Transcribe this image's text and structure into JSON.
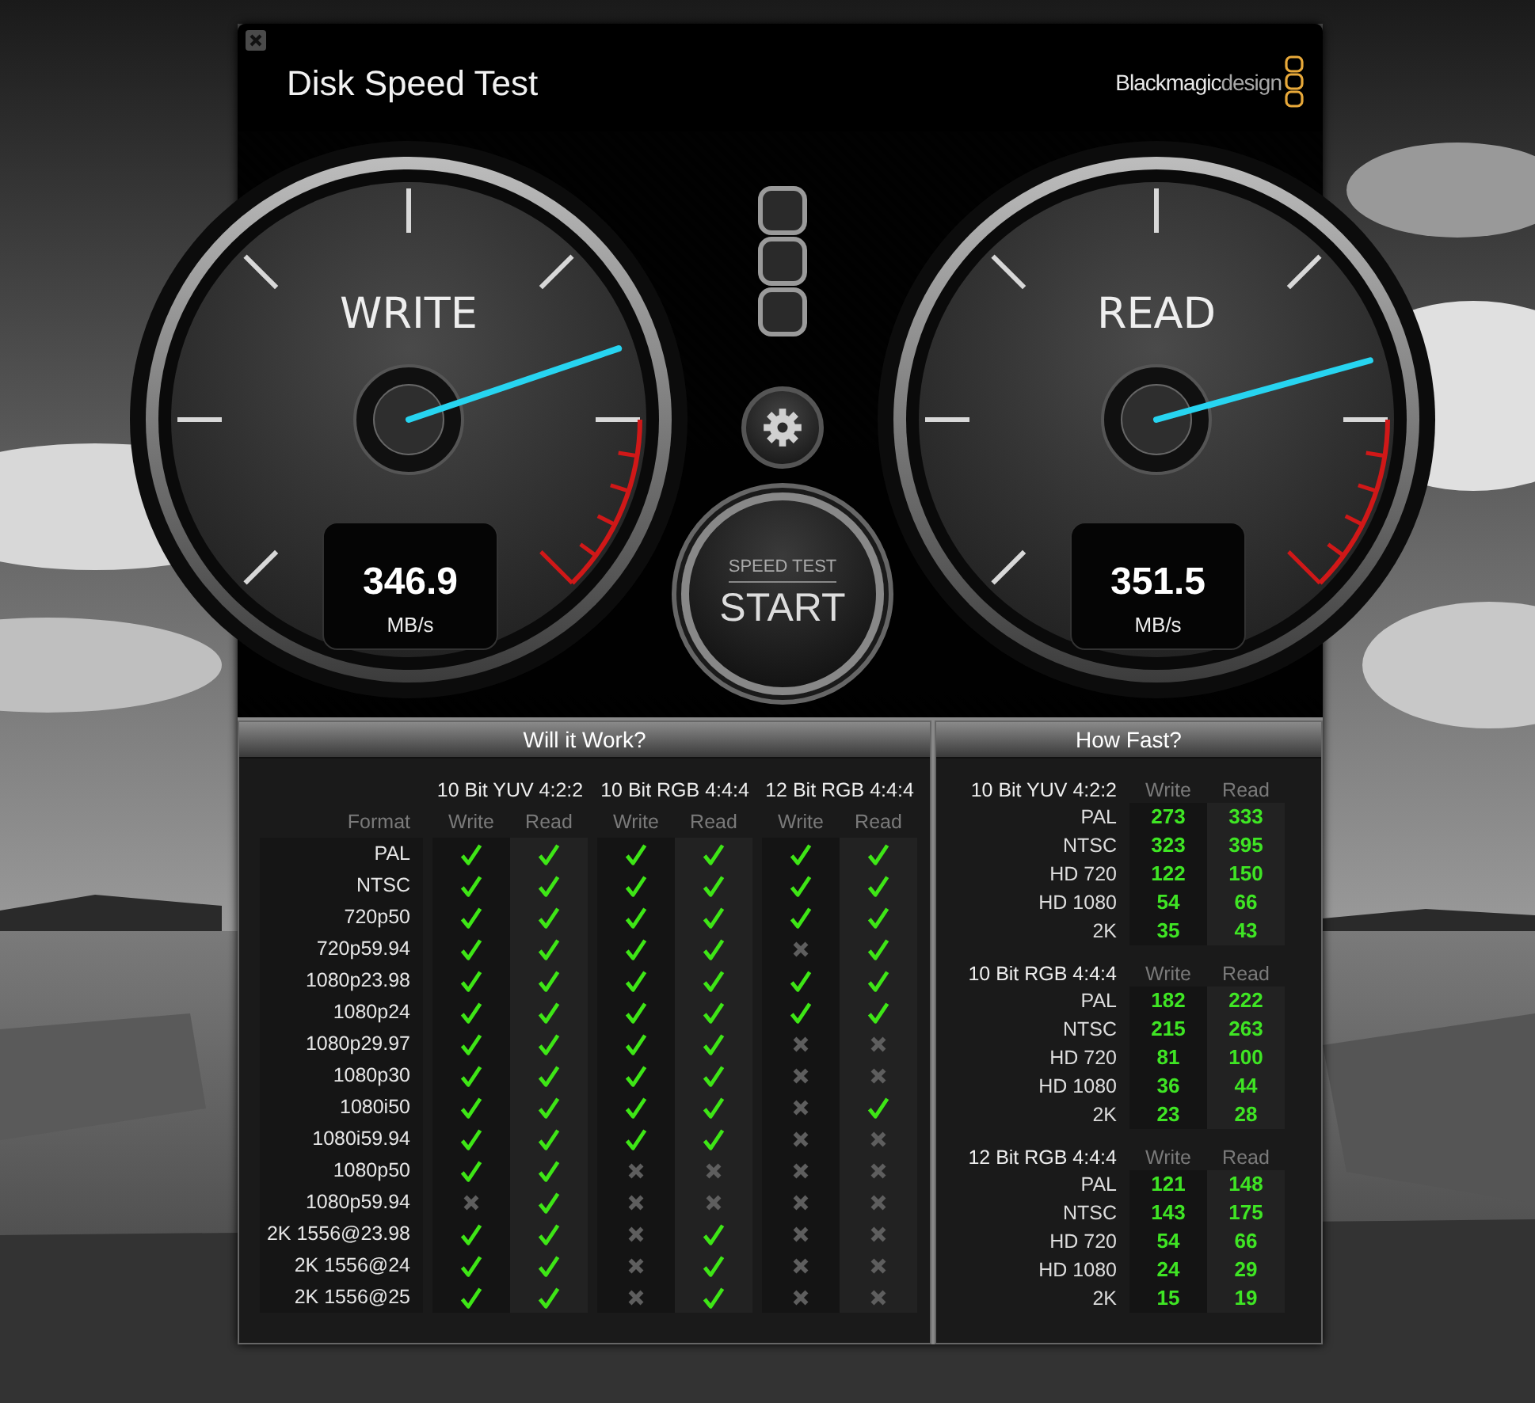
{
  "window": {
    "title": "Disk Speed Test"
  },
  "brand": {
    "name": "Blackmagic",
    "suffix": "design"
  },
  "gauges": [
    {
      "label": "WRITE",
      "value": "346.9",
      "unit": "MB/s",
      "level": 0.764
    },
    {
      "label": "READ",
      "value": "351.5",
      "unit": "MB/s",
      "level": 0.776
    }
  ],
  "start_button": {
    "caption": "SPEED TEST",
    "label": "START"
  },
  "will_it_work": {
    "title": "Will it Work?",
    "format_heading": "Format",
    "groups": [
      {
        "name": "10 Bit YUV 4:2:2",
        "columns": [
          "Write",
          "Read"
        ]
      },
      {
        "name": "10 Bit RGB 4:4:4",
        "columns": [
          "Write",
          "Read"
        ]
      },
      {
        "name": "12 Bit RGB 4:4:4",
        "columns": [
          "Write",
          "Read"
        ]
      }
    ],
    "rows": [
      {
        "format": "PAL",
        "results": [
          true,
          true,
          true,
          true,
          true,
          true
        ]
      },
      {
        "format": "NTSC",
        "results": [
          true,
          true,
          true,
          true,
          true,
          true
        ]
      },
      {
        "format": "720p50",
        "results": [
          true,
          true,
          true,
          true,
          true,
          true
        ]
      },
      {
        "format": "720p59.94",
        "results": [
          true,
          true,
          true,
          true,
          false,
          true
        ]
      },
      {
        "format": "1080p23.98",
        "results": [
          true,
          true,
          true,
          true,
          true,
          true
        ]
      },
      {
        "format": "1080p24",
        "results": [
          true,
          true,
          true,
          true,
          true,
          true
        ]
      },
      {
        "format": "1080p29.97",
        "results": [
          true,
          true,
          true,
          true,
          false,
          false
        ]
      },
      {
        "format": "1080p30",
        "results": [
          true,
          true,
          true,
          true,
          false,
          false
        ]
      },
      {
        "format": "1080i50",
        "results": [
          true,
          true,
          true,
          true,
          false,
          true
        ]
      },
      {
        "format": "1080i59.94",
        "results": [
          true,
          true,
          true,
          true,
          false,
          false
        ]
      },
      {
        "format": "1080p50",
        "results": [
          true,
          true,
          false,
          false,
          false,
          false
        ]
      },
      {
        "format": "1080p59.94",
        "results": [
          false,
          true,
          false,
          false,
          false,
          false
        ]
      },
      {
        "format": "2K 1556@23.98",
        "results": [
          true,
          true,
          false,
          true,
          false,
          false
        ]
      },
      {
        "format": "2K 1556@24",
        "results": [
          true,
          true,
          false,
          true,
          false,
          false
        ]
      },
      {
        "format": "2K 1556@25",
        "results": [
          true,
          true,
          false,
          true,
          false,
          false
        ]
      }
    ]
  },
  "how_fast": {
    "title": "How Fast?",
    "groups": [
      {
        "name": "10 Bit YUV 4:2:2",
        "columns": [
          "Write",
          "Read"
        ],
        "rows": [
          {
            "format": "PAL",
            "write": "273",
            "read": "333"
          },
          {
            "format": "NTSC",
            "write": "323",
            "read": "395"
          },
          {
            "format": "HD 720",
            "write": "122",
            "read": "150"
          },
          {
            "format": "HD 1080",
            "write": "54",
            "read": "66"
          },
          {
            "format": "2K",
            "write": "35",
            "read": "43"
          }
        ]
      },
      {
        "name": "10 Bit RGB 4:4:4",
        "columns": [
          "Write",
          "Read"
        ],
        "rows": [
          {
            "format": "PAL",
            "write": "182",
            "read": "222"
          },
          {
            "format": "NTSC",
            "write": "215",
            "read": "263"
          },
          {
            "format": "HD 720",
            "write": "81",
            "read": "100"
          },
          {
            "format": "HD 1080",
            "write": "36",
            "read": "44"
          },
          {
            "format": "2K",
            "write": "23",
            "read": "28"
          }
        ]
      },
      {
        "name": "12 Bit RGB 4:4:4",
        "columns": [
          "Write",
          "Read"
        ],
        "rows": [
          {
            "format": "PAL",
            "write": "121",
            "read": "148"
          },
          {
            "format": "NTSC",
            "write": "143",
            "read": "175"
          },
          {
            "format": "HD 720",
            "write": "54",
            "read": "66"
          },
          {
            "format": "HD 1080",
            "write": "24",
            "read": "29"
          },
          {
            "format": "2K",
            "write": "15",
            "read": "19"
          }
        ]
      }
    ]
  }
}
